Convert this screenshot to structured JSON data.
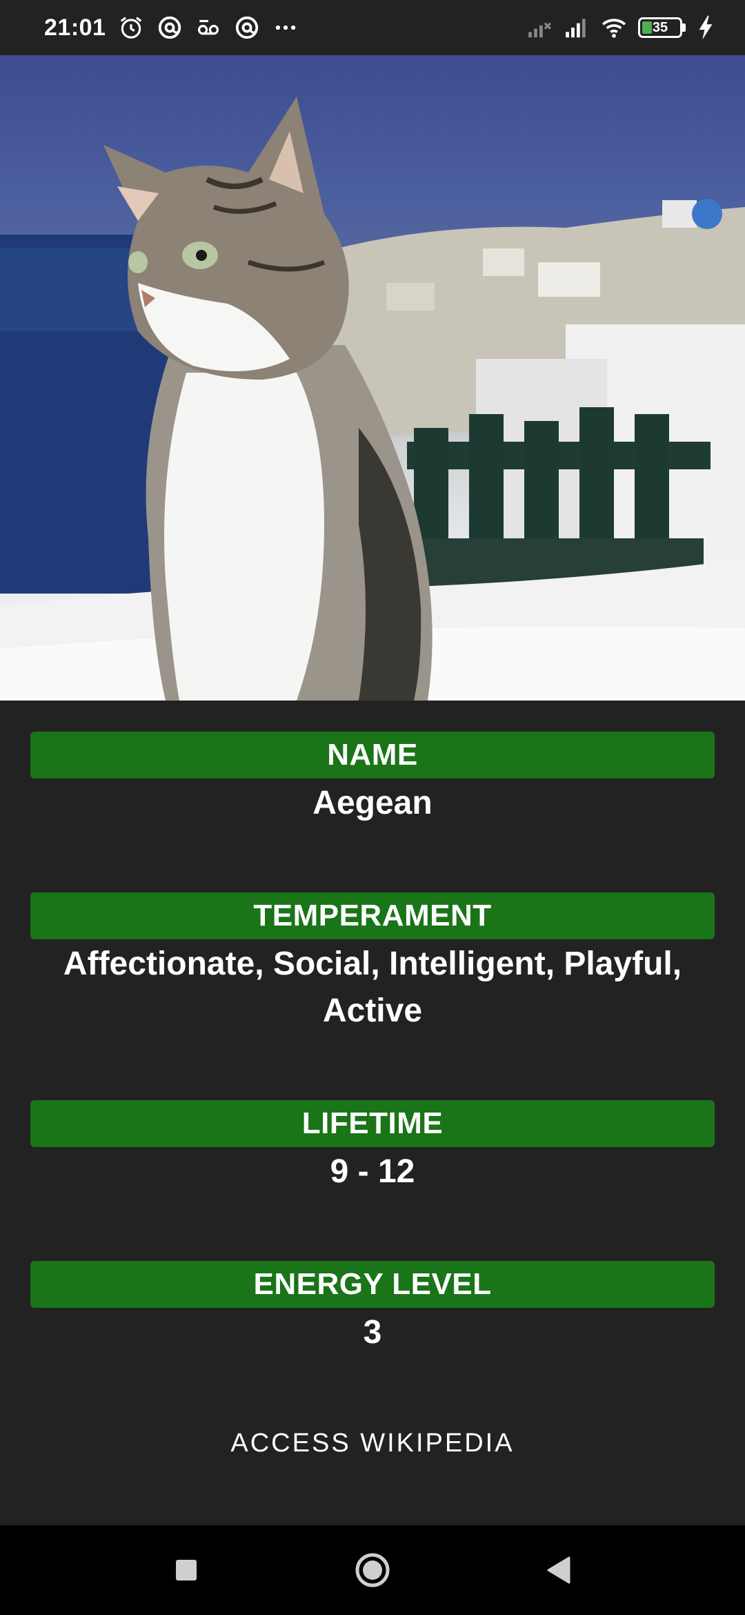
{
  "status_bar": {
    "time": "21:01",
    "left_icons": [
      "alarm-icon",
      "at-sign-icon",
      "voicemail-icon",
      "at-sign-icon",
      "more-dots-icon"
    ],
    "right_icons": [
      "signal-no-service-icon",
      "signal-icon",
      "wifi-icon"
    ],
    "battery_level": "35",
    "battery_fraction": 0.35,
    "charging_icon": "bolt-icon"
  },
  "hero_image": {
    "subject": "cat photo",
    "colors": {
      "sky": "#3d4d8f",
      "ground": "#f3f4f5"
    }
  },
  "details": [
    {
      "label": "NAME",
      "value": "Aegean"
    },
    {
      "label": "TEMPERAMENT",
      "value_line1": "Affectionate, Social, Intelligent, Playful,",
      "value_line2": "Active"
    },
    {
      "label": "LIFETIME",
      "value": "9 - 12"
    },
    {
      "label": "ENERGY LEVEL",
      "value": "3"
    }
  ],
  "wikipedia_button": "ACCESS WIKIPEDIA",
  "nav": {
    "recent": "square-icon",
    "home": "circle-icon",
    "back": "triangle-back-icon"
  },
  "colors": {
    "background": "#222222",
    "label_bar": "#1a7418",
    "text": "#ffffff",
    "nav_bar": "#000000"
  }
}
